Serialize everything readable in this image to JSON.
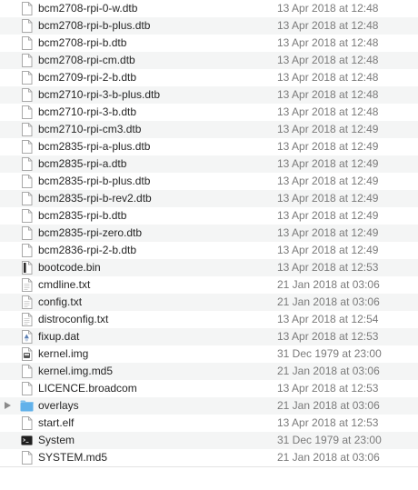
{
  "files": [
    {
      "name": "bcm2708-rpi-0-w.dtb",
      "date": "13 Apr 2018 at 12:48",
      "icon": "document-icon"
    },
    {
      "name": "bcm2708-rpi-b-plus.dtb",
      "date": "13 Apr 2018 at 12:48",
      "icon": "document-icon"
    },
    {
      "name": "bcm2708-rpi-b.dtb",
      "date": "13 Apr 2018 at 12:48",
      "icon": "document-icon"
    },
    {
      "name": "bcm2708-rpi-cm.dtb",
      "date": "13 Apr 2018 at 12:48",
      "icon": "document-icon"
    },
    {
      "name": "bcm2709-rpi-2-b.dtb",
      "date": "13 Apr 2018 at 12:48",
      "icon": "document-icon"
    },
    {
      "name": "bcm2710-rpi-3-b-plus.dtb",
      "date": "13 Apr 2018 at 12:48",
      "icon": "document-icon"
    },
    {
      "name": "bcm2710-rpi-3-b.dtb",
      "date": "13 Apr 2018 at 12:48",
      "icon": "document-icon"
    },
    {
      "name": "bcm2710-rpi-cm3.dtb",
      "date": "13 Apr 2018 at 12:49",
      "icon": "document-icon"
    },
    {
      "name": "bcm2835-rpi-a-plus.dtb",
      "date": "13 Apr 2018 at 12:49",
      "icon": "document-icon"
    },
    {
      "name": "bcm2835-rpi-a.dtb",
      "date": "13 Apr 2018 at 12:49",
      "icon": "document-icon"
    },
    {
      "name": "bcm2835-rpi-b-plus.dtb",
      "date": "13 Apr 2018 at 12:49",
      "icon": "document-icon"
    },
    {
      "name": "bcm2835-rpi-b-rev2.dtb",
      "date": "13 Apr 2018 at 12:49",
      "icon": "document-icon"
    },
    {
      "name": "bcm2835-rpi-b.dtb",
      "date": "13 Apr 2018 at 12:49",
      "icon": "document-icon"
    },
    {
      "name": "bcm2835-rpi-zero.dtb",
      "date": "13 Apr 2018 at 12:49",
      "icon": "document-icon"
    },
    {
      "name": "bcm2836-rpi-2-b.dtb",
      "date": "13 Apr 2018 at 12:49",
      "icon": "document-icon"
    },
    {
      "name": "bootcode.bin",
      "date": "13 Apr 2018 at 12:53",
      "icon": "binary-file-icon"
    },
    {
      "name": "cmdline.txt",
      "date": "21 Jan 2018 at 03:06",
      "icon": "text-file-icon"
    },
    {
      "name": "config.txt",
      "date": "21 Jan 2018 at 03:06",
      "icon": "text-file-icon"
    },
    {
      "name": "distroconfig.txt",
      "date": "13 Apr 2018 at 12:54",
      "icon": "text-file-icon"
    },
    {
      "name": "fixup.dat",
      "date": "13 Apr 2018 at 12:53",
      "icon": "data-file-icon"
    },
    {
      "name": "kernel.img",
      "date": "31 Dec 1979 at 23:00",
      "icon": "disk-image-icon"
    },
    {
      "name": "kernel.img.md5",
      "date": "21 Jan 2018 at 03:06",
      "icon": "document-icon"
    },
    {
      "name": "LICENCE.broadcom",
      "date": "13 Apr 2018 at 12:53",
      "icon": "document-icon"
    },
    {
      "name": "overlays",
      "date": "21 Jan 2018 at 03:06",
      "icon": "folder-icon",
      "folder": true
    },
    {
      "name": "start.elf",
      "date": "13 Apr 2018 at 12:53",
      "icon": "document-icon"
    },
    {
      "name": "System",
      "date": "31 Dec 1979 at 23:00",
      "icon": "terminal-icon"
    },
    {
      "name": "SYSTEM.md5",
      "date": "21 Jan 2018 at 03:06",
      "icon": "document-icon"
    }
  ]
}
